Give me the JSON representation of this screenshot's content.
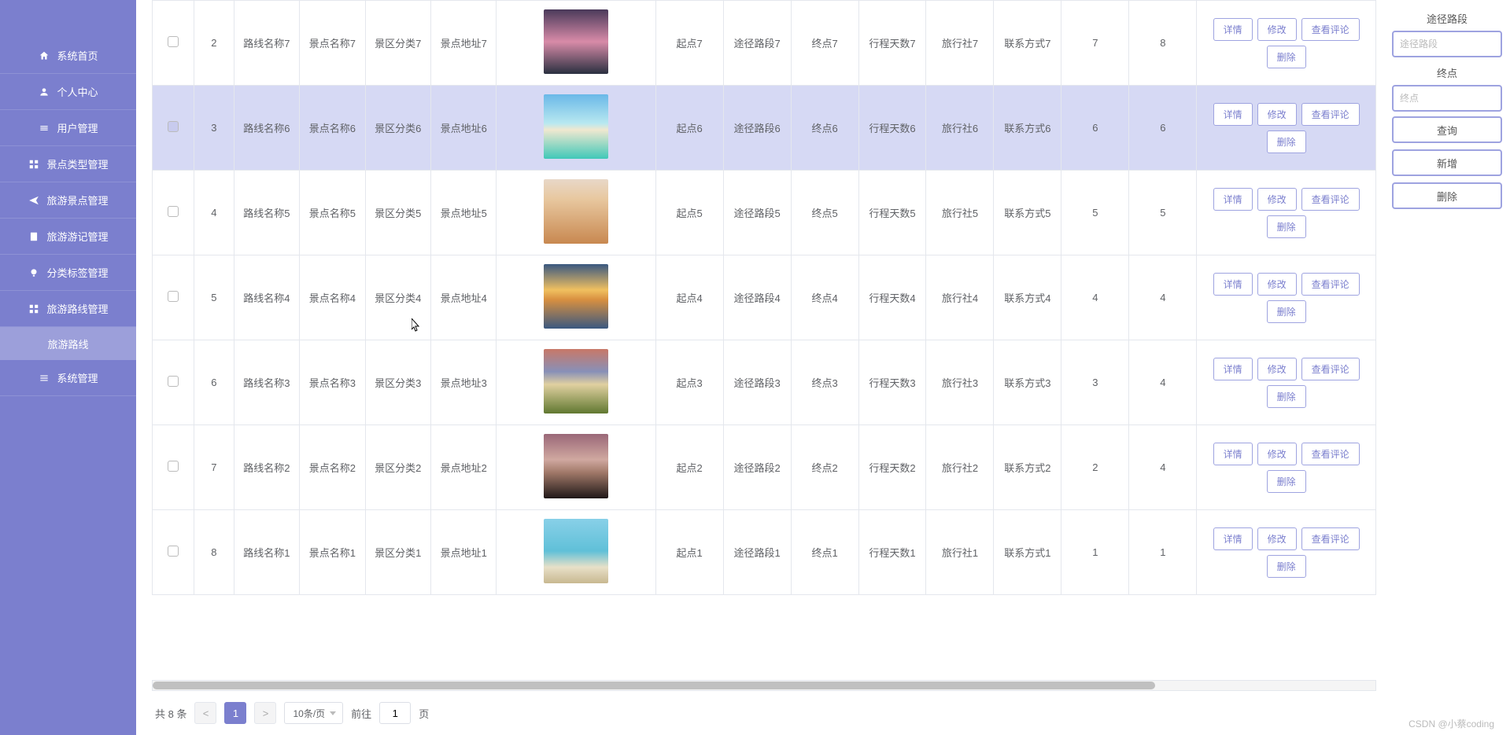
{
  "sidebar": {
    "items": [
      {
        "label": "系统首页",
        "icon": "home-icon"
      },
      {
        "label": "个人中心",
        "icon": "user-icon"
      },
      {
        "label": "用户管理",
        "icon": "users-icon"
      },
      {
        "label": "景点类型管理",
        "icon": "grid-icon"
      },
      {
        "label": "旅游景点管理",
        "icon": "send-icon"
      },
      {
        "label": "旅游游记管理",
        "icon": "doc-icon"
      },
      {
        "label": "分类标签管理",
        "icon": "bulb-icon"
      },
      {
        "label": "旅游路线管理",
        "icon": "route-icon"
      },
      {
        "label": "系统管理",
        "icon": "menu-icon"
      }
    ],
    "sub_label": "旅游路线"
  },
  "table": {
    "rows": [
      {
        "idx": "2",
        "route": "路线名称7",
        "spot": "景点名称7",
        "cat": "景区分类7",
        "addr": "景点地址7",
        "thumb": "sunset1",
        "start": "起点7",
        "seg": "途径路段7",
        "end": "终点7",
        "days": "行程天数7",
        "agency": "旅行社7",
        "contact": "联系方式7",
        "n1": "7",
        "n2": "8",
        "highlight": false
      },
      {
        "idx": "3",
        "route": "路线名称6",
        "spot": "景点名称6",
        "cat": "景区分类6",
        "addr": "景点地址6",
        "thumb": "beach",
        "start": "起点6",
        "seg": "途径路段6",
        "end": "终点6",
        "days": "行程天数6",
        "agency": "旅行社6",
        "contact": "联系方式6",
        "n1": "6",
        "n2": "6",
        "highlight": true
      },
      {
        "idx": "4",
        "route": "路线名称5",
        "spot": "景点名称5",
        "cat": "景区分类5",
        "addr": "景点地址5",
        "thumb": "desert",
        "start": "起点5",
        "seg": "途径路段5",
        "end": "终点5",
        "days": "行程天数5",
        "agency": "旅行社5",
        "contact": "联系方式5",
        "n1": "5",
        "n2": "5",
        "highlight": false
      },
      {
        "idx": "5",
        "route": "路线名称4",
        "spot": "景点名称4",
        "cat": "景区分类4",
        "addr": "景点地址4",
        "thumb": "clouds",
        "start": "起点4",
        "seg": "途径路段4",
        "end": "终点4",
        "days": "行程天数4",
        "agency": "旅行社4",
        "contact": "联系方式4",
        "n1": "4",
        "n2": "4",
        "highlight": false
      },
      {
        "idx": "6",
        "route": "路线名称3",
        "spot": "景点名称3",
        "cat": "景区分类3",
        "addr": "景点地址3",
        "thumb": "meadow",
        "start": "起点3",
        "seg": "途径路段3",
        "end": "终点3",
        "days": "行程天数3",
        "agency": "旅行社3",
        "contact": "联系方式3",
        "n1": "3",
        "n2": "4",
        "highlight": false
      },
      {
        "idx": "7",
        "route": "路线名称2",
        "spot": "景点名称2",
        "cat": "景区分类2",
        "addr": "景点地址2",
        "thumb": "dusk",
        "start": "起点2",
        "seg": "途径路段2",
        "end": "终点2",
        "days": "行程天数2",
        "agency": "旅行社2",
        "contact": "联系方式2",
        "n1": "2",
        "n2": "4",
        "highlight": false
      },
      {
        "idx": "8",
        "route": "路线名称1",
        "spot": "景点名称1",
        "cat": "景区分类1",
        "addr": "景点地址1",
        "thumb": "tropical",
        "start": "起点1",
        "seg": "途径路段1",
        "end": "终点1",
        "days": "行程天数1",
        "agency": "旅行社1",
        "contact": "联系方式1",
        "n1": "1",
        "n2": "1",
        "highlight": false
      }
    ],
    "ops": {
      "detail": "详情",
      "edit": "修改",
      "comments": "查看评论",
      "delete": "删除"
    }
  },
  "pagination": {
    "total_prefix": "共 ",
    "total_count": "8",
    "total_suffix": " 条",
    "prev": "<",
    "next": ">",
    "current": "1",
    "per_page": "10条/页",
    "goto_prefix": "前往",
    "goto_value": "1",
    "goto_suffix": "页"
  },
  "right_panel": {
    "seg_label": "途径路段",
    "seg_placeholder": "途径路段",
    "end_label": "终点",
    "end_placeholder": "终点",
    "query": "查询",
    "add": "新增",
    "delete": "删除"
  },
  "watermark": "CSDN @小蔡coding"
}
